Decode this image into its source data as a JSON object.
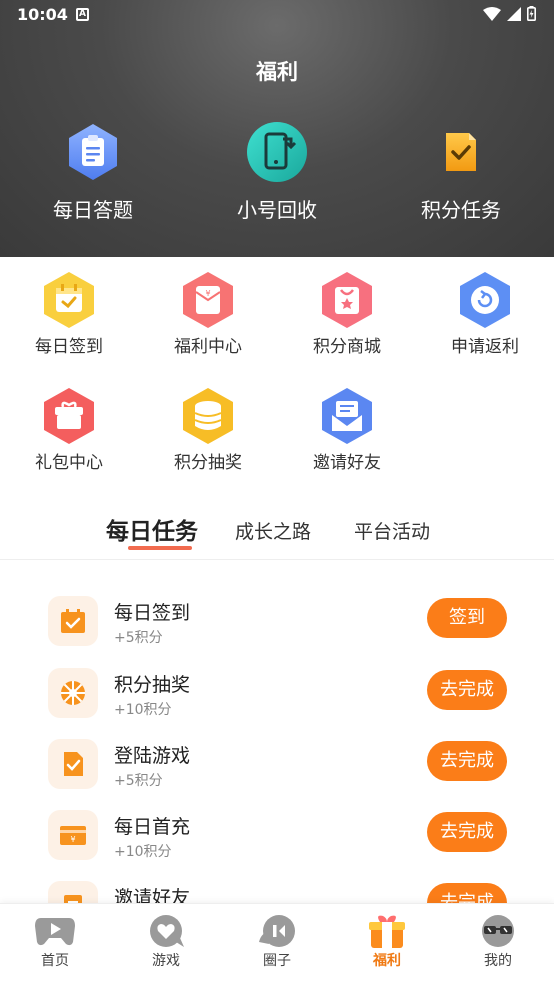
{
  "status": {
    "time": "10:04",
    "a_icon": "A"
  },
  "header": {
    "title": "福利",
    "features": [
      {
        "label": "每日答题",
        "icon": "clipboard-icon"
      },
      {
        "label": "小号回收",
        "icon": "phone-recycle-icon"
      },
      {
        "label": "积分任务",
        "icon": "task-doc-icon"
      }
    ]
  },
  "grid": [
    {
      "label": "每日签到",
      "icon": "calendar-icon",
      "color": "#f7c52b"
    },
    {
      "label": "福利中心",
      "icon": "red-envelope-icon",
      "color": "#f76b6b"
    },
    {
      "label": "积分商城",
      "icon": "shopping-bag-icon",
      "color": "#f76b7e"
    },
    {
      "label": "申请返利",
      "icon": "refund-icon",
      "color": "#5b8df5"
    },
    {
      "label": "礼包中心",
      "icon": "gift-box-icon",
      "color": "#f45b5b"
    },
    {
      "label": "积分抽奖",
      "icon": "coin-stack-icon",
      "color": "#f6b61e"
    },
    {
      "label": "邀请好友",
      "icon": "invite-mail-icon",
      "color": "#5b86f0"
    }
  ],
  "tabs": [
    {
      "label": "每日任务"
    },
    {
      "label": "成长之路"
    },
    {
      "label": "平台活动"
    }
  ],
  "tasks": [
    {
      "title": "每日签到",
      "reward": "+5积分",
      "button": "签到",
      "icon": "calendar-check-icon"
    },
    {
      "title": "积分抽奖",
      "reward": "+10积分",
      "button": "去完成",
      "icon": "lottery-wheel-icon"
    },
    {
      "title": "登陆游戏",
      "reward": "+5积分",
      "button": "去完成",
      "icon": "doc-check-icon"
    },
    {
      "title": "每日首充",
      "reward": "+10积分",
      "button": "去完成",
      "icon": "recharge-card-icon"
    },
    {
      "title": "邀请好友",
      "reward": "",
      "button": "去完成",
      "icon": "invite-doc-icon"
    }
  ],
  "bottom_nav": [
    {
      "label": "首页",
      "icon": "gamepad-icon"
    },
    {
      "label": "游戏",
      "icon": "heart-bubble-icon"
    },
    {
      "label": "圈子",
      "icon": "chat-circle-icon"
    },
    {
      "label": "福利",
      "icon": "gift-icon"
    },
    {
      "label": "我的",
      "icon": "sunglasses-face-icon"
    }
  ],
  "colors": {
    "accent": "#fb7d18",
    "tab_underline": "#f26b4f",
    "header_bg": "#4a4a4a"
  }
}
